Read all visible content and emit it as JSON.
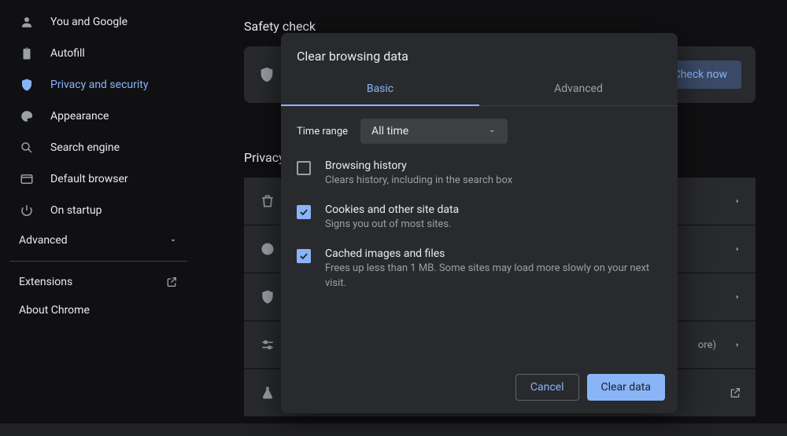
{
  "sidebar": {
    "items": [
      {
        "label": "You and Google"
      },
      {
        "label": "Autofill"
      },
      {
        "label": "Privacy and security"
      },
      {
        "label": "Appearance"
      },
      {
        "label": "Search engine"
      },
      {
        "label": "Default browser"
      },
      {
        "label": "On startup"
      }
    ],
    "advanced_label": "Advanced",
    "extensions_label": "Extensions",
    "about_label": "About Chrome"
  },
  "main": {
    "safety_check_title": "Safety check",
    "check_now_label": "Check now",
    "privacy_title": "Privacy and security"
  },
  "dialog": {
    "title": "Clear browsing data",
    "tabs": {
      "basic": "Basic",
      "advanced": "Advanced"
    },
    "time_range_label": "Time range",
    "time_range_value": "All time",
    "options": [
      {
        "title": "Browsing history",
        "desc": "Clears history, including in the search box",
        "checked": false
      },
      {
        "title": "Cookies and other site data",
        "desc": "Signs you out of most sites.",
        "checked": true
      },
      {
        "title": "Cached images and files",
        "desc": "Frees up less than 1 MB. Some sites may load more slowly on your next visit.",
        "checked": true
      }
    ],
    "cancel_label": "Cancel",
    "clear_label": "Clear data"
  }
}
